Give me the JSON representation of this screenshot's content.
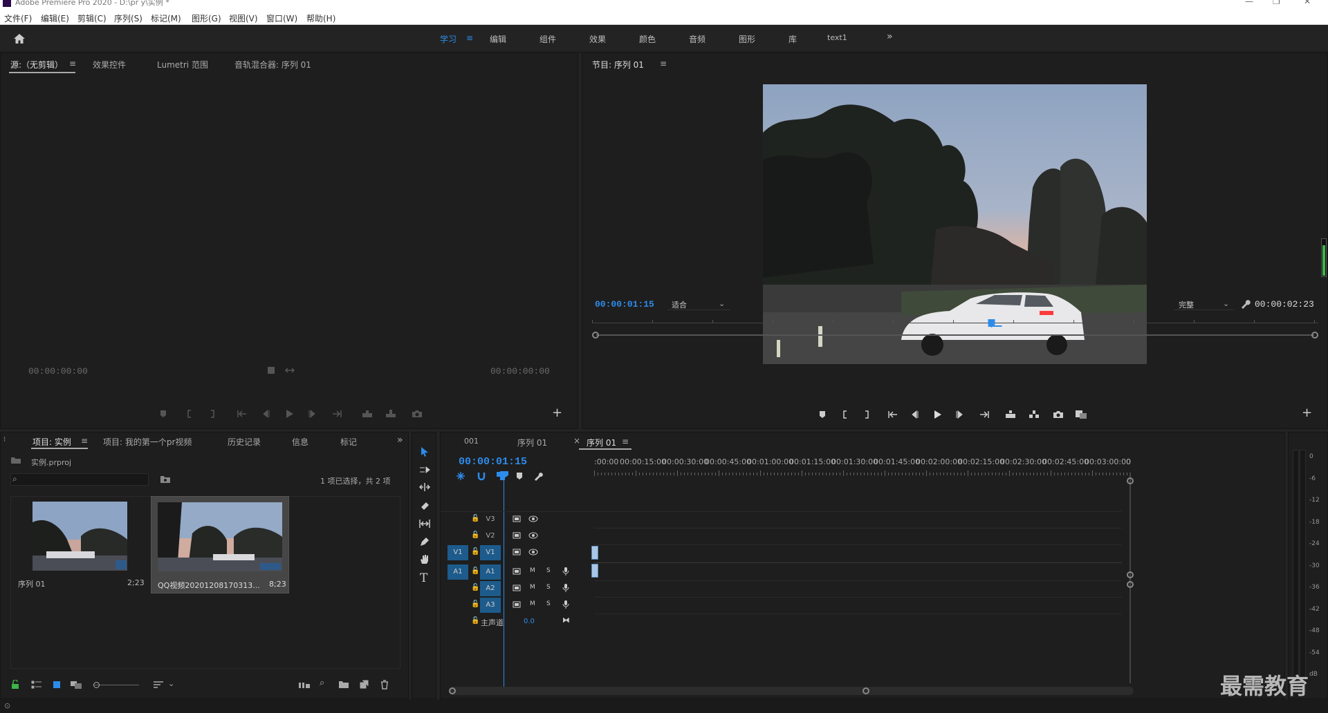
{
  "window": {
    "title": "Adobe Premiere Pro 2020 - D:\\pr y\\实例 *"
  },
  "menu": [
    "文件(F)",
    "编辑(E)",
    "剪辑(C)",
    "序列(S)",
    "标记(M)",
    "图形(G)",
    "视图(V)",
    "窗口(W)",
    "帮助(H)"
  ],
  "workspaces": [
    "学习",
    "编辑",
    "组件",
    "效果",
    "颜色",
    "音频",
    "图形",
    "库",
    "text1"
  ],
  "source_panel": {
    "tabs": [
      "源:（无剪辑）",
      "效果控件",
      "Lumetri 范围",
      "音轨混合器: 序列 01"
    ],
    "timecode_left": "00:00:00:00",
    "timecode_right": "00:00:00:00"
  },
  "program_panel": {
    "tab": "节目: 序列 01",
    "timecode": "00:00:01:15",
    "fit": "适合",
    "quality": "完整",
    "duration": "00:00:02:23",
    "playhead_fraction": 0.55
  },
  "project_panel": {
    "tabs": [
      "项目: 实例",
      "项目: 我的第一个pr视频",
      "历史记录",
      "信息",
      "标记"
    ],
    "file": "实例.prproj",
    "selection_status": "1 项已选择，共 2 项",
    "items": [
      {
        "name": "序列 01",
        "duration": "2;23"
      },
      {
        "name": "QQ视频20201208170313...",
        "duration": "8;23"
      }
    ]
  },
  "timeline": {
    "tabs": [
      "001",
      "序列 01",
      "序列 01"
    ],
    "timecode": "00:00:01:15",
    "ruler": [
      ":00:00",
      "00:00:15:00",
      "00:00:30:00",
      "00:00:45:00",
      "00:01:00:00",
      "00:01:15:00",
      "00:01:30:00",
      "00:01:45:00",
      "00:02:00:00",
      "00:02:15:00",
      "00:02:30:00",
      "00:02:45:00",
      "00:03:00:00",
      "0"
    ],
    "video_tracks": [
      "V3",
      "V2",
      "V1"
    ],
    "audio_tracks": [
      "A1",
      "A2",
      "A3"
    ],
    "source_v": "V1",
    "source_a": "A1",
    "mute": "M",
    "solo": "S",
    "master_label": "主声道",
    "master_value": "0.0"
  },
  "meter": {
    "ticks": [
      "0",
      "-6",
      "-12",
      "-18",
      "-24",
      "-30",
      "-36",
      "-42",
      "-48",
      "-54",
      "dB"
    ]
  },
  "watermark": "最需教育",
  "colors": {
    "accent": "#2d8ceb",
    "track_target": "#1d5b8c",
    "panel_bg": "#1e1e1e"
  }
}
